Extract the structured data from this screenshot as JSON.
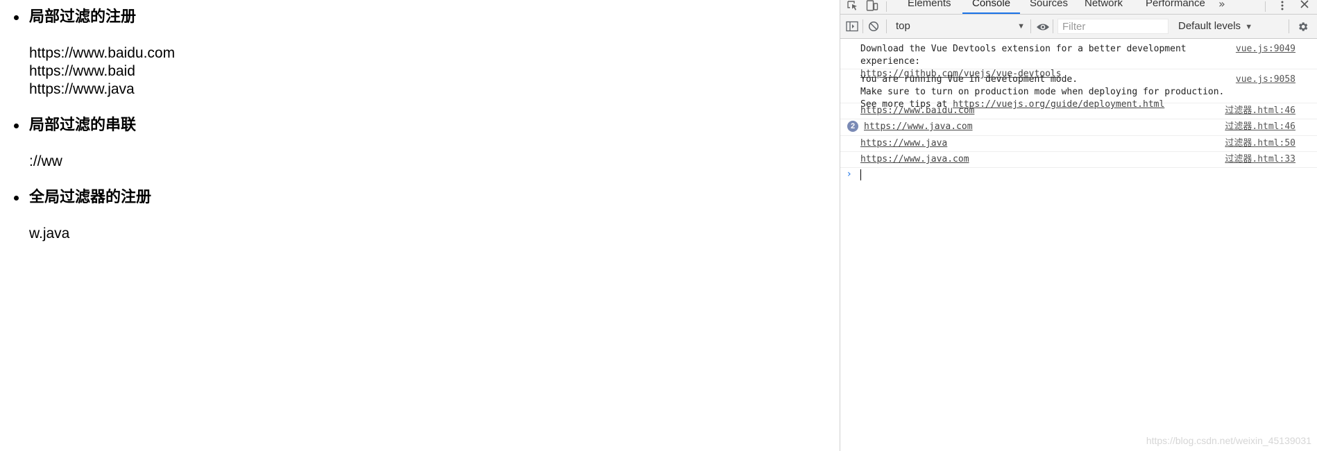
{
  "page": {
    "sections": [
      {
        "title": "局部过滤的注册",
        "lines": [
          "https://www.baidu.com",
          "https://www.baid",
          "https://www.java"
        ]
      },
      {
        "title": "局部过滤的串联",
        "lines": [
          "://ww"
        ]
      },
      {
        "title": "全局过滤器的注册",
        "lines": [
          "w.java"
        ]
      }
    ]
  },
  "devtools": {
    "tabs": [
      "Elements",
      "Console",
      "Sources",
      "Network",
      "Performance"
    ],
    "active_tab": "Console",
    "more_tabs_icon": "double-chevron-right-icon",
    "toolbar": {
      "context": "top",
      "filter_placeholder": "Filter",
      "levels": "Default levels"
    },
    "messages": [
      {
        "text": "Download the Vue Devtools extension for a better development\nexperience:\n",
        "link": "https://github.com/vuejs/vue-devtools",
        "source": "vue.js:9049"
      },
      {
        "text": "You are running Vue in development mode.\nMake sure to turn on production mode when deploying for production.\nSee more tips at ",
        "link": "https://vuejs.org/guide/deployment.html",
        "source": "vue.js:9058"
      },
      {
        "text": "",
        "link": "https://www.baidu.com",
        "source": "过滤器.html:46"
      },
      {
        "text": "",
        "link": "https://www.java.com",
        "source": "过滤器.html:46",
        "repeat": "2"
      },
      {
        "text": "",
        "link": "https://www.java",
        "source": "过滤器.html:50"
      },
      {
        "text": "",
        "link": "https://www.java.com",
        "source": "过滤器.html:33"
      }
    ],
    "accent": "#1a73e8"
  },
  "watermark": "https://blog.csdn.net/weixin_45139031"
}
